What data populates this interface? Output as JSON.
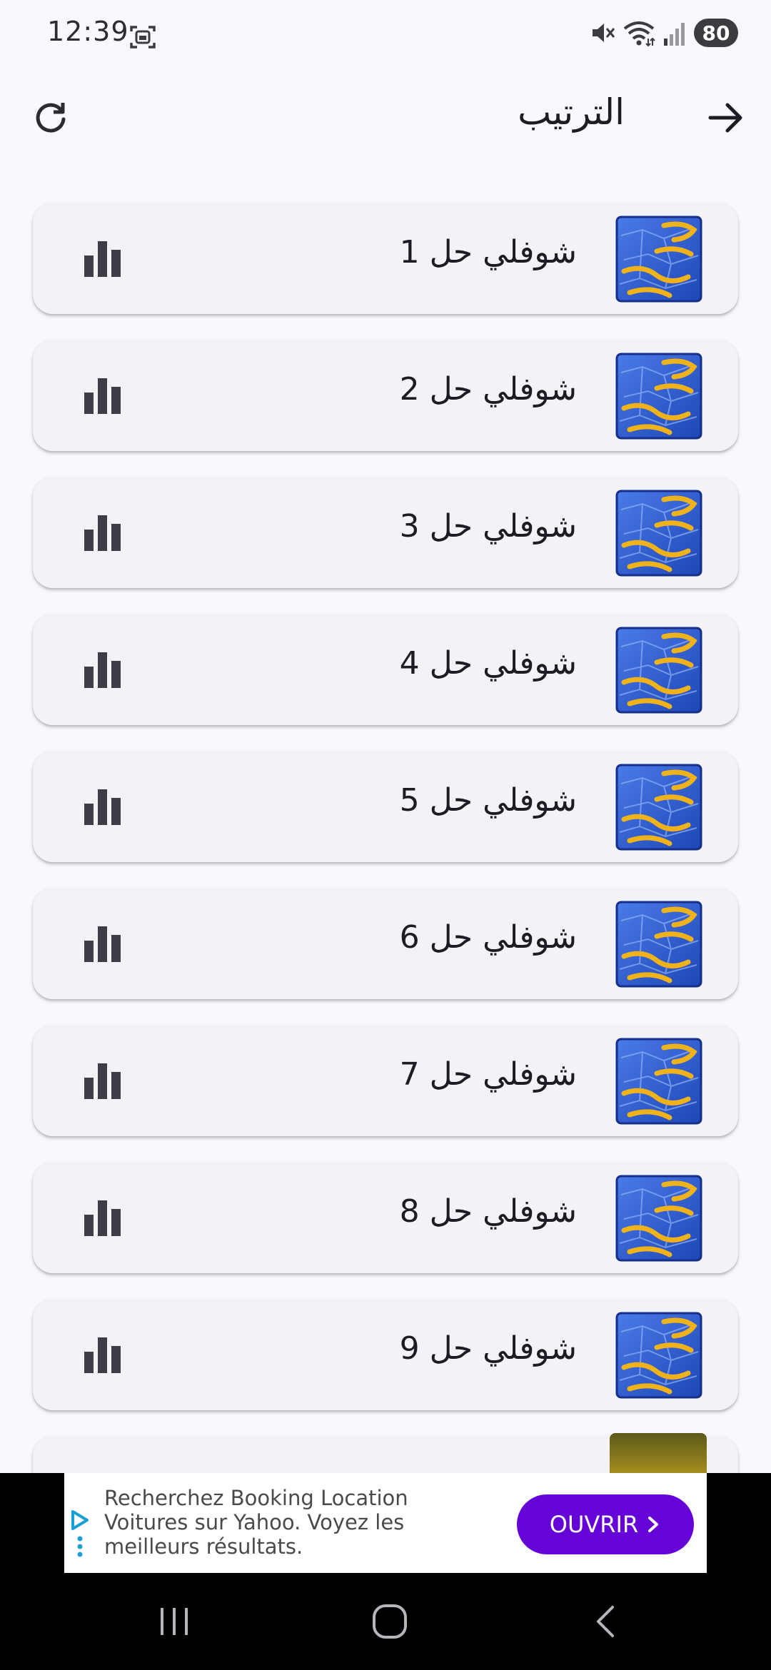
{
  "status_bar": {
    "time": "12:39",
    "battery": "80",
    "icons": [
      "screenshot-icon",
      "mute-icon",
      "wifi-icon",
      "signal-icon"
    ]
  },
  "app_bar": {
    "title": "الترتيب",
    "left_icon": "refresh-icon",
    "right_icon": "arrow-forward-icon"
  },
  "list": {
    "items": [
      {
        "title": "شوفلي حل 1",
        "icon": "bar-chart-icon"
      },
      {
        "title": "شوفلي حل 2",
        "icon": "bar-chart-icon"
      },
      {
        "title": "شوفلي حل 3",
        "icon": "bar-chart-icon"
      },
      {
        "title": "شوفلي حل 4",
        "icon": "bar-chart-icon"
      },
      {
        "title": "شوفلي حل 5",
        "icon": "bar-chart-icon"
      },
      {
        "title": "شوفلي حل 6",
        "icon": "bar-chart-icon"
      },
      {
        "title": "شوفلي حل 7",
        "icon": "bar-chart-icon"
      },
      {
        "title": "شوفلي حل 8",
        "icon": "bar-chart-icon"
      },
      {
        "title": "شوفلي حل 9",
        "icon": "bar-chart-icon"
      }
    ]
  },
  "ad": {
    "text": "Recherchez Booking Location Voitures sur Yahoo. Voyez les meilleurs résultats.",
    "button_label": "OUVRIR"
  },
  "colors": {
    "background": "#f8f8fd",
    "card": "#f2f2f7",
    "ad_button": "#6404d6",
    "thumb_blue": "#2f5fd0",
    "thumb_gold": "#e6b422"
  }
}
